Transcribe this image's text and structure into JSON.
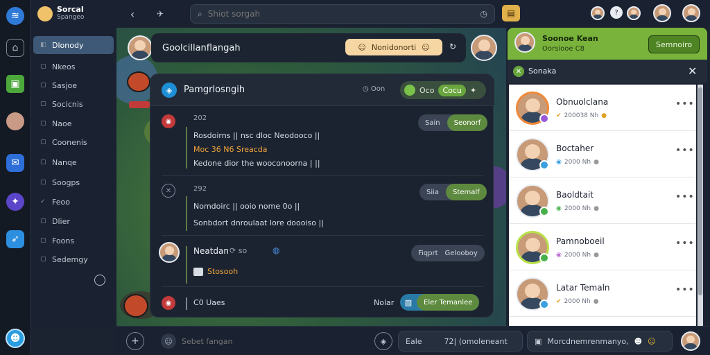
{
  "brand": {
    "line1": "Sorcal",
    "line2": "Spangeo"
  },
  "sidebar": {
    "items": [
      {
        "label": "Dlonody",
        "active": true
      },
      {
        "label": "Nkeos"
      },
      {
        "label": "Sasjoe"
      },
      {
        "label": "Socicnis"
      },
      {
        "label": "Naoe"
      },
      {
        "label": "Coonenis"
      },
      {
        "label": "Nanqe"
      },
      {
        "label": "Soogps"
      },
      {
        "label": "Feoo"
      },
      {
        "label": "Dlier"
      },
      {
        "label": "Foons"
      },
      {
        "label": "Sedemgy"
      }
    ]
  },
  "search": {
    "placeholder": "Shiot sorgah"
  },
  "chat_header": {
    "title": "Goolcillanflangah",
    "badge": "Nonidonorti"
  },
  "panel": {
    "title": "Pamgrlosngih",
    "meta": "Oon",
    "pill_a": "Oco",
    "pill_b": "Cocu",
    "rows": [
      {
        "time": "202",
        "lines": [
          "Rosdoirns || nsc dloc Neodooco ||",
          "Moc 36 N6 Sreacda",
          "Kedone dior the wooconoorna | ||"
        ],
        "btn_a": "Sain",
        "btn_b": "Seonorf"
      },
      {
        "time": "292",
        "lines": [
          "Nomdoirc || ooio nome 0o ||",
          "Sonbdort dnroulaat lore doooiso ||"
        ],
        "btn_a": "Siia",
        "btn_b": "Stemalf"
      },
      {
        "name": "Neatdan",
        "sub": "so",
        "lines": [
          "Stosooh"
        ],
        "btn_a": "Fiqprt",
        "btn_b": "Gelooboy"
      },
      {
        "time": "C0",
        "title": "Uaes",
        "note": "Nolar",
        "btn_b": "Eler Temanlee"
      }
    ]
  },
  "right_panel": {
    "header": {
      "name": "Soonoe Kean",
      "sub": "Oorsiooe C8",
      "button": "Semnoiro"
    },
    "tab_label": "Sonaka",
    "contacts": [
      {
        "name": "Obnuolclana",
        "meta": "200038 Nh",
        "ring": "#f08a3a",
        "dot": "#9a58d6"
      },
      {
        "name": "Boctaher",
        "meta": "2000 Nh",
        "ring": "#ffffff",
        "dot": "#3aa0e0"
      },
      {
        "name": "Baoldtait",
        "meta": "2000 Nh",
        "ring": "#ffffff",
        "dot": "#48b04a"
      },
      {
        "name": "Pamnoboeil",
        "meta": "2000 Nh",
        "ring": "#b9e04a",
        "dot": "#48b04a"
      },
      {
        "name": "Latar Temaln",
        "meta": "2000 Nh",
        "ring": "#ffffff",
        "dot": "#3aa0e0"
      }
    ]
  },
  "bottom": {
    "input_placeholder": "Sebet fangan",
    "field2_label": "Eale",
    "field2_value": "72| (omoleneant",
    "field3_value": "Morcdnemrenmanyo,"
  },
  "colors": {
    "accent": "#79b33b",
    "active": "#3e5877",
    "panel": "#1c2330"
  },
  "icons": [
    "home-icon",
    "grid-icon",
    "avatar",
    "chat-icon",
    "game-icon",
    "bird-icon",
    "search-icon",
    "back-icon",
    "plus-icon",
    "emoji-icon",
    "close-icon"
  ]
}
